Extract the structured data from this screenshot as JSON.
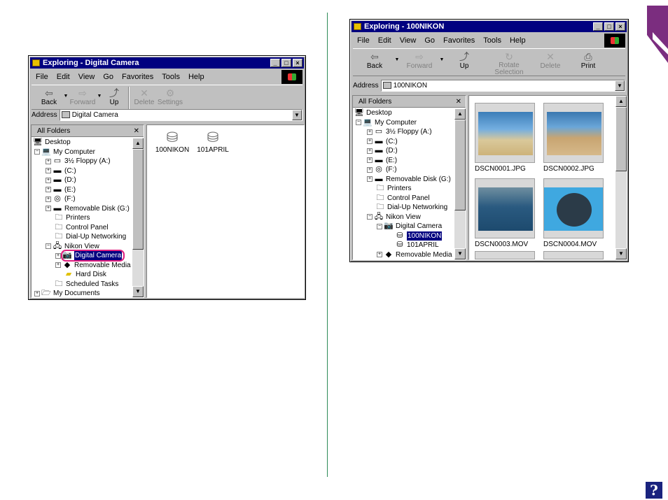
{
  "left_window": {
    "title": "Exploring - Digital Camera",
    "menu": [
      "File",
      "Edit",
      "View",
      "Go",
      "Favorites",
      "Tools",
      "Help"
    ],
    "toolbar": {
      "back": "Back",
      "forward": "Forward",
      "up": "Up",
      "delete": "Delete",
      "settings": "Settings"
    },
    "address_label": "Address",
    "address_value": "Digital Camera",
    "tree_header": "All Folders",
    "tree": [
      "Desktop",
      "My Computer",
      "3½ Floppy (A:)",
      "(C:)",
      "(D:)",
      "(E:)",
      "(F:)",
      "Removable Disk (G:)",
      "Printers",
      "Control Panel",
      "Dial-Up Networking",
      "Nikon View",
      "Digital Camera",
      "Removable Media",
      "Hard Disk",
      "Scheduled Tasks",
      "My Documents"
    ],
    "folders": [
      "100NIKON",
      "101APRIL"
    ]
  },
  "right_window": {
    "title": "Exploring - 100NIKON",
    "menu": [
      "File",
      "Edit",
      "View",
      "Go",
      "Favorites",
      "Tools",
      "Help"
    ],
    "toolbar": {
      "back": "Back",
      "forward": "Forward",
      "up": "Up",
      "rotate": "Rotate Selection",
      "delete": "Delete",
      "print": "Print"
    },
    "address_label": "Address",
    "address_value": "100NIKON",
    "tree_header": "All Folders",
    "tree": [
      "Desktop",
      "My Computer",
      "3½ Floppy (A:)",
      "(C:)",
      "(D:)",
      "(E:)",
      "(F:)",
      "Removable Disk (G:)",
      "Printers",
      "Control Panel",
      "Dial-Up Networking",
      "Nikon View",
      "Digital Camera",
      "100NIKON",
      "101APRIL",
      "Removable Media"
    ],
    "thumbnails": [
      "DSCN0001.JPG",
      "DSCN0002.JPG",
      "DSCN0003.MOV",
      "DSCN0004.MOV"
    ]
  },
  "help_glyph": "?",
  "colors": {
    "desktop_bg": "#ffffff",
    "title_bar": "#000080",
    "chrome": "#c0c0c0",
    "accent_purple": "#7b2d7f",
    "divider_green": "#2e8b57",
    "highlight_pink": "#e0207f",
    "help_blue": "#1a237e"
  }
}
